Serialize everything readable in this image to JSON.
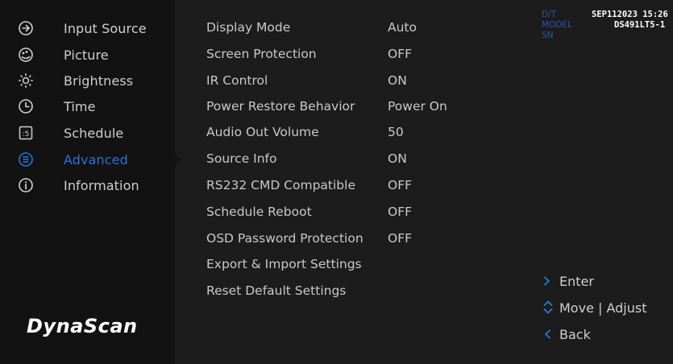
{
  "sidebar": {
    "items": [
      {
        "label": "Input Source",
        "icon": "input-source-icon"
      },
      {
        "label": "Picture",
        "icon": "picture-icon"
      },
      {
        "label": "Brightness",
        "icon": "brightness-icon"
      },
      {
        "label": "Time",
        "icon": "clock-icon"
      },
      {
        "label": "Schedule",
        "icon": "schedule-icon"
      },
      {
        "label": "Advanced",
        "icon": "advanced-icon",
        "active": true
      },
      {
        "label": "Information",
        "icon": "info-icon"
      }
    ],
    "logo": "DynaScan"
  },
  "menu": {
    "rows": [
      {
        "label": "Display Mode",
        "value": "Auto"
      },
      {
        "label": "Screen Protection",
        "value": "OFF"
      },
      {
        "label": "IR Control",
        "value": "ON"
      },
      {
        "label": "Power Restore Behavior",
        "value": "Power On"
      },
      {
        "label": "Audio Out Volume",
        "value": "50"
      },
      {
        "label": "Source Info",
        "value": "ON"
      },
      {
        "label": "RS232 CMD Compatible",
        "value": "OFF"
      },
      {
        "label": "Schedule Reboot",
        "value": "OFF"
      },
      {
        "label": "OSD Password Protection",
        "value": "OFF"
      },
      {
        "label": "Export & Import Settings",
        "value": ""
      },
      {
        "label": "Reset Default Settings",
        "value": ""
      }
    ]
  },
  "info": {
    "dt_label": "D/T",
    "dt_value": "SEP112023 15:26",
    "model_label": "MODEL",
    "model_value": "DS491LT5-1",
    "sn_label": "SN",
    "sn_value": ""
  },
  "hints": {
    "enter": "Enter",
    "move_adjust": "Move | Adjust",
    "back": "Back"
  },
  "colors": {
    "accent": "#2f6fd6",
    "sidebar_bg": "#121212",
    "main_bg": "#1c1c1c"
  }
}
